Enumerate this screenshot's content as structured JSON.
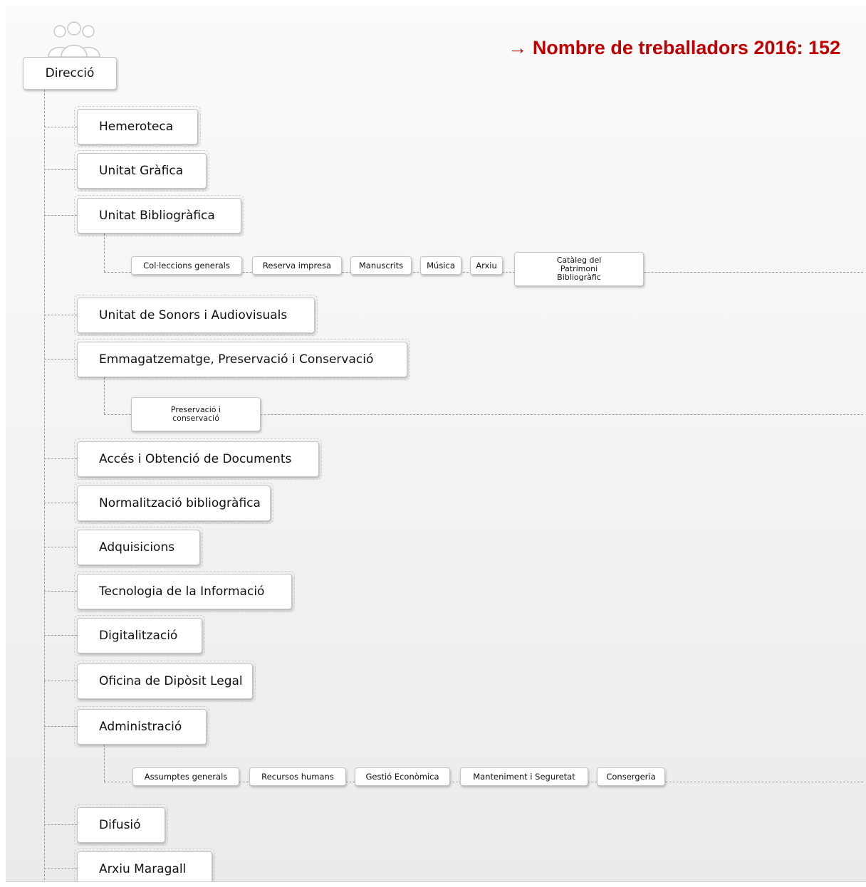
{
  "headline": {
    "arrow": "→",
    "text": "Nombre de treballadors 2016: 152",
    "color": "#c00000"
  },
  "root": {
    "label": "Direcció",
    "icon": "people-icon"
  },
  "departments": [
    {
      "label": "Hemeroteca"
    },
    {
      "label": "Unitat Gràfica"
    },
    {
      "label": "Unitat Bibliogràfica",
      "children": [
        "Col·leccions generals",
        "Reserva impresa",
        "Manuscrits",
        "Música",
        "Arxiu",
        "Catàleg del Patrimoni Bibliogràfic"
      ]
    },
    {
      "label": "Unitat de Sonors i Audiovisuals"
    },
    {
      "label": "Emmagatzematge, Preservació i Conservació",
      "children": [
        "Preservació i conservació"
      ]
    },
    {
      "label": "Accés i Obtenció de Documents"
    },
    {
      "label": "Normalització bibliogràfica"
    },
    {
      "label": "Adquisicions"
    },
    {
      "label": "Tecnologia de la Informació"
    },
    {
      "label": "Digitalització"
    },
    {
      "label": "Oficina de Dipòsit Legal"
    },
    {
      "label": "Administració",
      "children": [
        "Assumptes generals",
        "Recursos humans",
        "Gestió Econòmica",
        "Manteniment i Seguretat",
        "Consergeria"
      ]
    },
    {
      "label": "Difusió"
    },
    {
      "label": "Arxiu Maragall"
    }
  ]
}
